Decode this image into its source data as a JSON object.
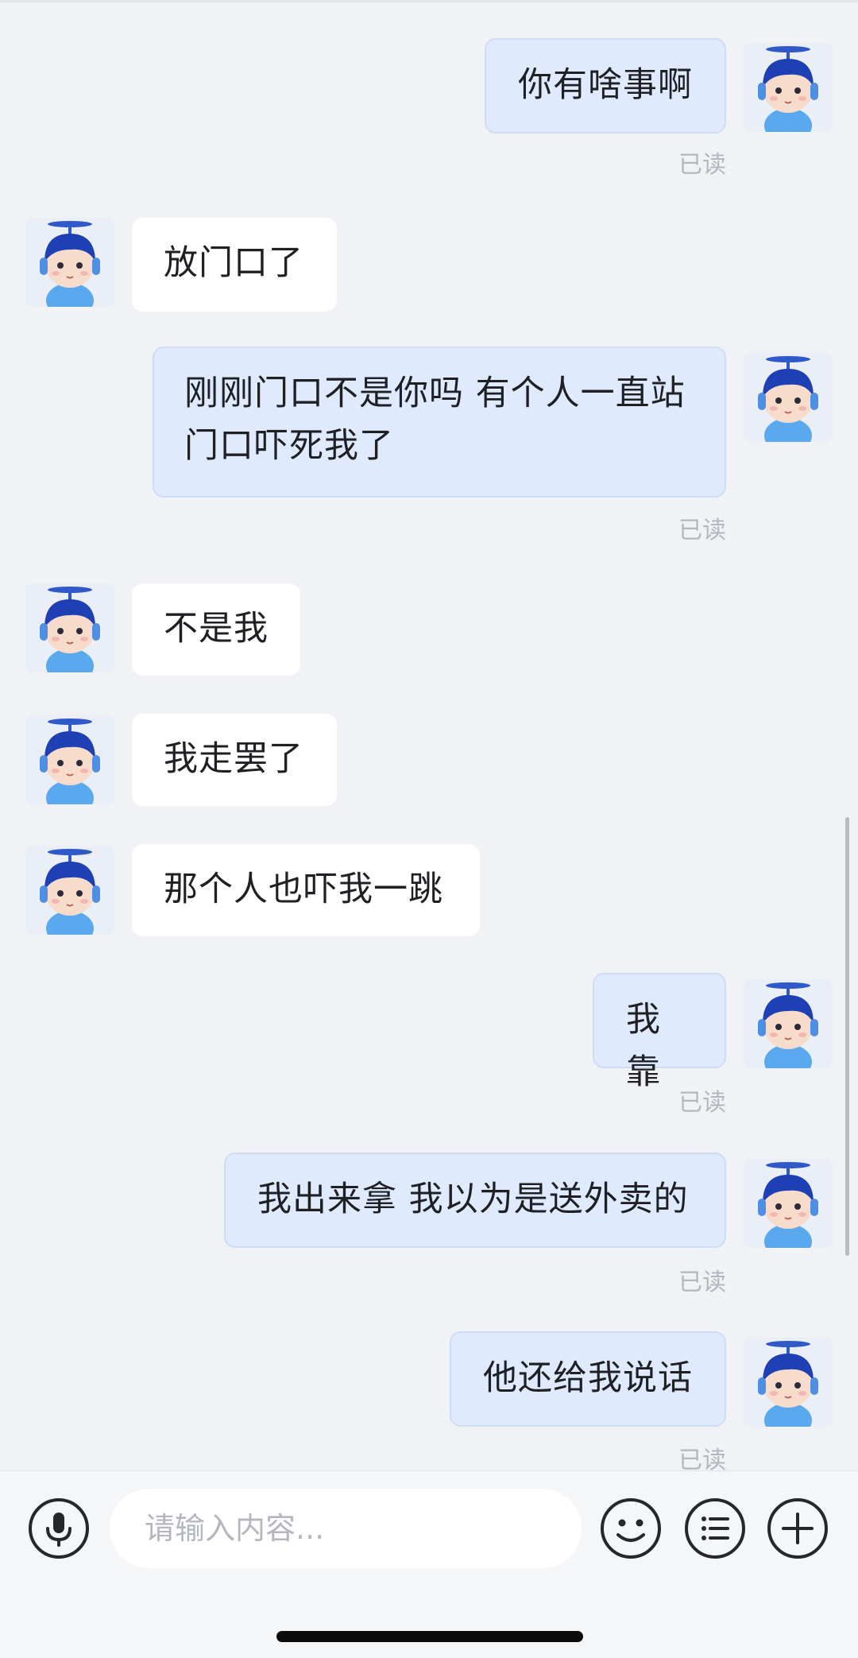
{
  "colors": {
    "background": "#f1f2f6",
    "outgoing_bubble": "#dfeaff",
    "incoming_bubble": "#ffffff",
    "read_text": "#b4b7bd",
    "text": "#1f2024"
  },
  "messages": [
    {
      "direction": "out",
      "text": "你有啥事啊",
      "status": "已读"
    },
    {
      "direction": "in",
      "text": "放门口了"
    },
    {
      "direction": "out",
      "line1": "刚刚门口不是你吗 有个人一直站",
      "line2": "门口吓死我了",
      "status": "已读"
    },
    {
      "direction": "in",
      "text": "不是我"
    },
    {
      "direction": "in",
      "text": "我走罢了"
    },
    {
      "direction": "in",
      "text": "那个人也吓我一跳"
    },
    {
      "direction": "out",
      "text": "我靠",
      "status": "已读"
    },
    {
      "direction": "out",
      "text": "我出来拿 我以为是送外卖的",
      "status": "已读"
    },
    {
      "direction": "out",
      "text": "他还给我说话",
      "status": "已读"
    }
  ],
  "input_bar": {
    "placeholder": "请输入内容...",
    "icons": {
      "voice": "microphone-icon",
      "emoji": "smiley-icon",
      "menu": "list-icon",
      "more": "plus-icon"
    }
  }
}
